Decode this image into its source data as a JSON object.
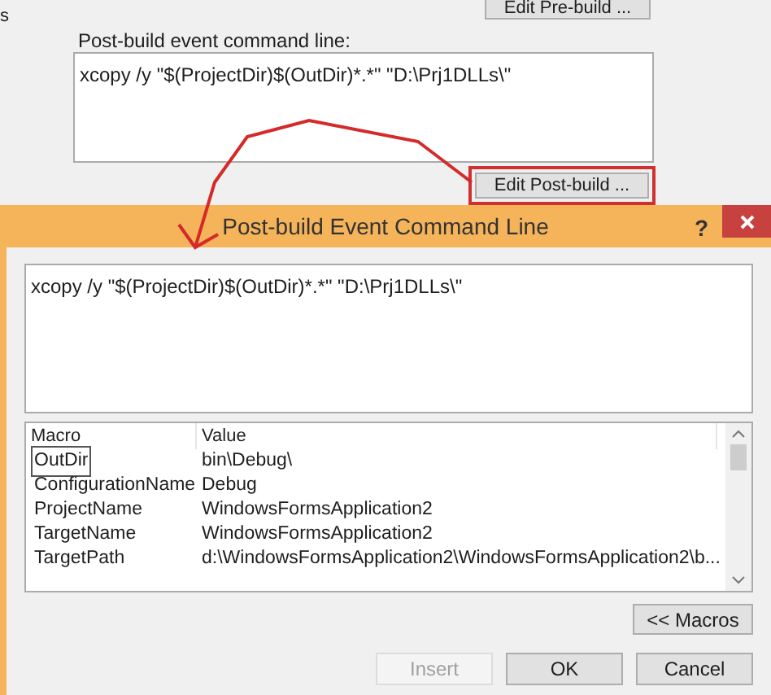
{
  "background": {
    "edge_text": "s",
    "edit_prebuild_button": "Edit Pre-build ...",
    "command_label": "Post-build event command line:",
    "command_value": "xcopy /y \"$(ProjectDir)$(OutDir)*.*\" \"D:\\Prj1DLLs\\\"",
    "edit_postbuild_button": "Edit Post-build ..."
  },
  "dialog": {
    "title": "Post-build Event Command Line",
    "help": "?",
    "command_value": "xcopy /y \"$(ProjectDir)$(OutDir)*.*\" \"D:\\Prj1DLLs\\\"",
    "table": {
      "columns": [
        "Macro",
        "Value"
      ],
      "rows": [
        {
          "macro": "OutDir",
          "value": "bin\\Debug\\",
          "selected": true
        },
        {
          "macro": "ConfigurationName",
          "value": "Debug",
          "selected": false
        },
        {
          "macro": "ProjectName",
          "value": "WindowsFormsApplication2",
          "selected": false
        },
        {
          "macro": "TargetName",
          "value": "WindowsFormsApplication2",
          "selected": false
        },
        {
          "macro": "TargetPath",
          "value": "d:\\WindowsFormsApplication2\\WindowsFormsApplication2\\b...",
          "selected": false
        }
      ]
    },
    "macros_button": "<< Macros",
    "buttons": [
      {
        "label": "Insert",
        "disabled": true
      },
      {
        "label": "OK",
        "disabled": false
      },
      {
        "label": "Cancel",
        "disabled": false
      }
    ]
  }
}
